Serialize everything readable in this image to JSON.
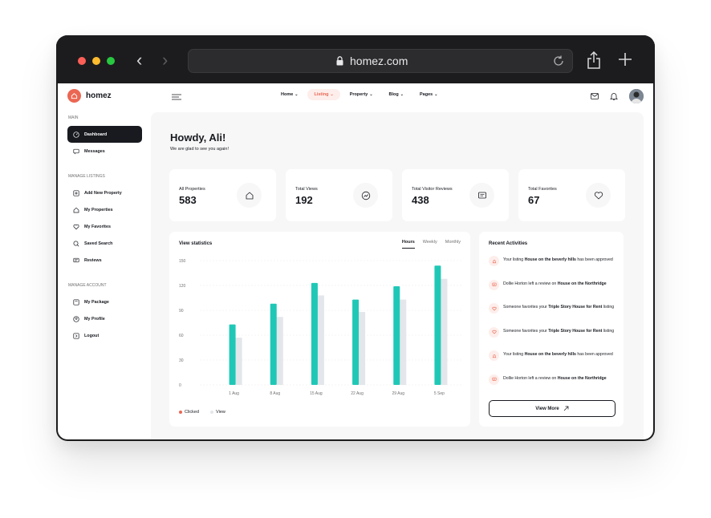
{
  "browser": {
    "url": "homez.com"
  },
  "brand": {
    "name": "homez",
    "accent": "#eb6753",
    "dark": "#181a20",
    "teal": "#1fc8b6"
  },
  "topnav": [
    {
      "label": "Home",
      "active": false
    },
    {
      "label": "Listing",
      "active": true
    },
    {
      "label": "Property",
      "active": false
    },
    {
      "label": "Blog",
      "active": false
    },
    {
      "label": "Pages",
      "active": false
    }
  ],
  "sidebar": {
    "main_title": "MAIN",
    "main_items": [
      {
        "label": "Dashboard",
        "icon": "dashboard-icon",
        "active": true
      },
      {
        "label": "Messages",
        "icon": "messages-icon",
        "active": false
      }
    ],
    "listings_title": "MANAGE LISTINGS",
    "listings_items": [
      {
        "label": "Add New Property",
        "icon": "add-property-icon"
      },
      {
        "label": "My Properties",
        "icon": "home-icon"
      },
      {
        "label": "My Favorites",
        "icon": "heart-icon"
      },
      {
        "label": "Saved Search",
        "icon": "search-icon"
      },
      {
        "label": "Reviews",
        "icon": "review-icon"
      }
    ],
    "account_title": "MANAGE ACCOUNT",
    "account_items": [
      {
        "label": "My Package",
        "icon": "package-icon"
      },
      {
        "label": "My Profile",
        "icon": "profile-icon"
      },
      {
        "label": "Logout",
        "icon": "logout-icon"
      }
    ]
  },
  "greeting": {
    "title": "Howdy, Ali!",
    "subtitle": "We are glad to see you again!"
  },
  "stats": [
    {
      "label": "All Properties",
      "value": "583",
      "icon": "home-icon"
    },
    {
      "label": "Total Views",
      "value": "192",
      "icon": "trend-icon"
    },
    {
      "label": "Total Visitor Reviews",
      "value": "438",
      "icon": "review-icon"
    },
    {
      "label": "Total Favorites",
      "value": "67",
      "icon": "heart-icon"
    }
  ],
  "chart_card": {
    "title": "View statistics",
    "tabs": [
      {
        "label": "Hours",
        "active": true
      },
      {
        "label": "Weekly",
        "active": false
      },
      {
        "label": "Monthly",
        "active": false
      }
    ]
  },
  "chart_data": {
    "type": "bar",
    "categories": [
      "1 Aug",
      "8 Aug",
      "15 Aug",
      "22 Aug",
      "29 Aug",
      "5 Sep"
    ],
    "series": [
      {
        "name": "Clicked",
        "color": "#1fc8b6",
        "values": [
          73,
          98,
          123,
          103,
          119,
          144
        ]
      },
      {
        "name": "View",
        "color": "#e3e6ea",
        "values": [
          57,
          82,
          108,
          88,
          103,
          128
        ]
      }
    ],
    "yticks": [
      "0",
      "30",
      "60",
      "90",
      "120",
      "150"
    ],
    "ylim": [
      0,
      150
    ],
    "grid": true,
    "legend_position": "bottom-left"
  },
  "activities": {
    "title": "Recent Activities",
    "items": [
      {
        "icon": "bell-icon",
        "prefix": "Your listing ",
        "bold": "House on the beverly hills",
        "suffix": " has been approved"
      },
      {
        "icon": "review-icon",
        "prefix": "Dollie Horton left a review on ",
        "bold": "House on the Northridge",
        "suffix": ""
      },
      {
        "icon": "heart-icon",
        "prefix": "Someone favorites your ",
        "bold": "Triple Story House for Rent",
        "suffix": " listing"
      },
      {
        "icon": "heart-icon",
        "prefix": "Someone favorites your ",
        "bold": "Triple Story House for Rent",
        "suffix": " listing"
      },
      {
        "icon": "bell-icon",
        "prefix": "Your listing ",
        "bold": "House on the beverly hills",
        "suffix": " has been approved"
      },
      {
        "icon": "review-icon",
        "prefix": "Dollie Horton left a review on ",
        "bold": "House on the Northridge",
        "suffix": ""
      }
    ],
    "view_more": "View More"
  }
}
